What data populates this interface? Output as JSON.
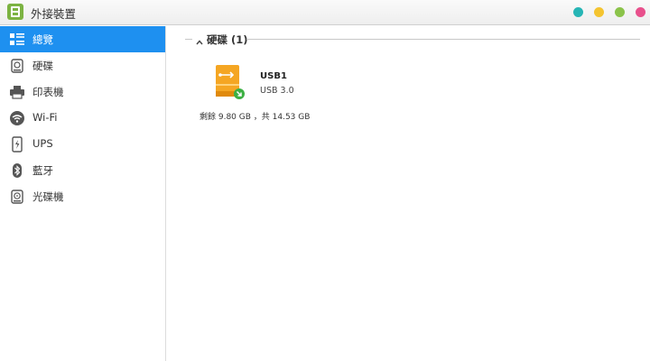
{
  "window": {
    "title": "外接裝置",
    "buttons": [
      {
        "name": "teal",
        "color": "#26b5b5"
      },
      {
        "name": "yellow",
        "color": "#f4c430"
      },
      {
        "name": "green",
        "color": "#8bc34a"
      },
      {
        "name": "pink",
        "color": "#e8508c"
      }
    ]
  },
  "theme": {
    "accent": "#1e90f0",
    "usb_orange": "#f5a623",
    "usb_badge": "#3cb043"
  },
  "sidebar": {
    "items": [
      {
        "label": "總覽",
        "icon": "overview-list-icon",
        "active": true
      },
      {
        "label": "硬碟",
        "icon": "hard-disk-icon",
        "active": false
      },
      {
        "label": "印表機",
        "icon": "printer-icon",
        "active": false
      },
      {
        "label": "Wi-Fi",
        "icon": "wifi-icon",
        "active": false
      },
      {
        "label": "UPS",
        "icon": "ups-icon",
        "active": false
      },
      {
        "label": "藍牙",
        "icon": "bluetooth-icon",
        "active": false
      },
      {
        "label": "光碟機",
        "icon": "optical-drive-icon",
        "active": false
      }
    ]
  },
  "main": {
    "section": {
      "title": "硬碟 (1)",
      "collapsed": false
    },
    "devices": [
      {
        "name": "USB1",
        "type": "USB 3.0",
        "storage": "剩餘 9.80 GB ，共 14.53 GB",
        "icon": "usb-drive-icon"
      }
    ]
  }
}
